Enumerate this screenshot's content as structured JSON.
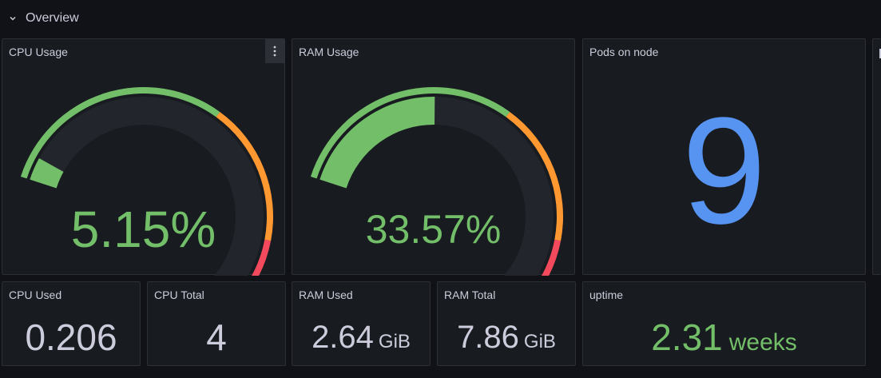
{
  "row": {
    "title": "Overview"
  },
  "cpu_gauge": {
    "title": "CPU Usage",
    "value": "5.15",
    "unit": "%",
    "fraction": 0.0515,
    "colors": {
      "base": "#73bf69",
      "warn": "#ff9830",
      "crit": "#f2495c",
      "track": "#22252b"
    }
  },
  "ram_gauge": {
    "title": "RAM Usage",
    "value": "33.57",
    "unit": "%",
    "fraction": 0.3357,
    "colors": {
      "base": "#73bf69",
      "warn": "#ff9830",
      "crit": "#f2495c",
      "track": "#22252b"
    }
  },
  "pods": {
    "title": "Pods on node",
    "value": "9",
    "color": "#5794f2"
  },
  "cpu_used": {
    "title": "CPU Used",
    "value": "0.206"
  },
  "cpu_total": {
    "title": "CPU Total",
    "value": "4"
  },
  "ram_used": {
    "title": "RAM Used",
    "value": "2.64",
    "unit": "GiB"
  },
  "ram_total": {
    "title": "RAM Total",
    "value": "7.86",
    "unit": "GiB"
  },
  "uptime": {
    "title": "uptime",
    "value": "2.31",
    "unit": "weeks",
    "color": "#73bf69"
  }
}
